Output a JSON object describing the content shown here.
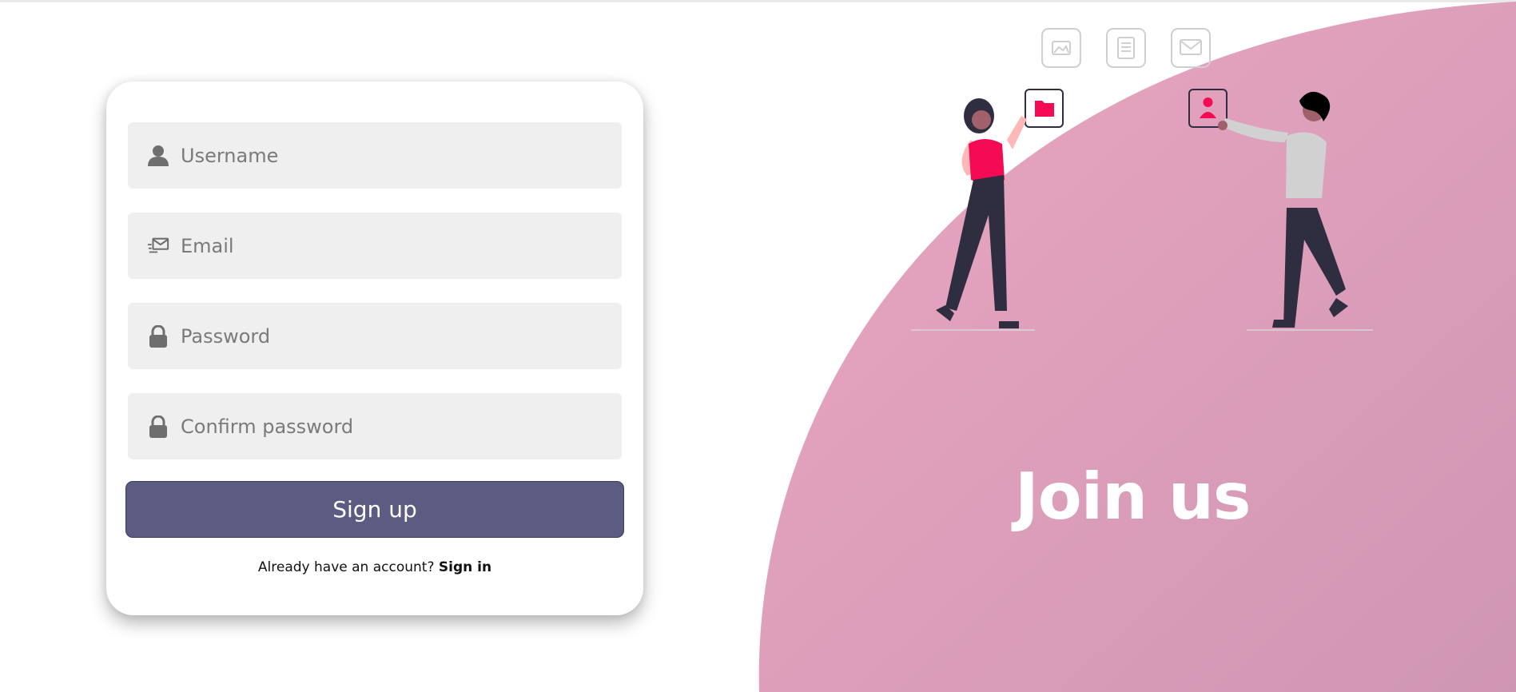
{
  "form": {
    "username_placeholder": "Username",
    "email_placeholder": "Email",
    "password_placeholder": "Password",
    "confirm_password_placeholder": "Confirm password",
    "submit_label": "Sign up",
    "signin_prompt": "Already have an account?",
    "signin_link": "Sign in"
  },
  "panel": {
    "title": "Join us"
  },
  "icons": {
    "username": "user-icon",
    "email": "mail-icon",
    "password": "lock-icon",
    "confirm_password": "lock-icon"
  },
  "colors": {
    "button": "#5c5c82",
    "panel_start": "#eba7c0",
    "panel_end": "#cf96b4",
    "field_bg": "#efefef",
    "accent_pink": "#f50a54"
  }
}
